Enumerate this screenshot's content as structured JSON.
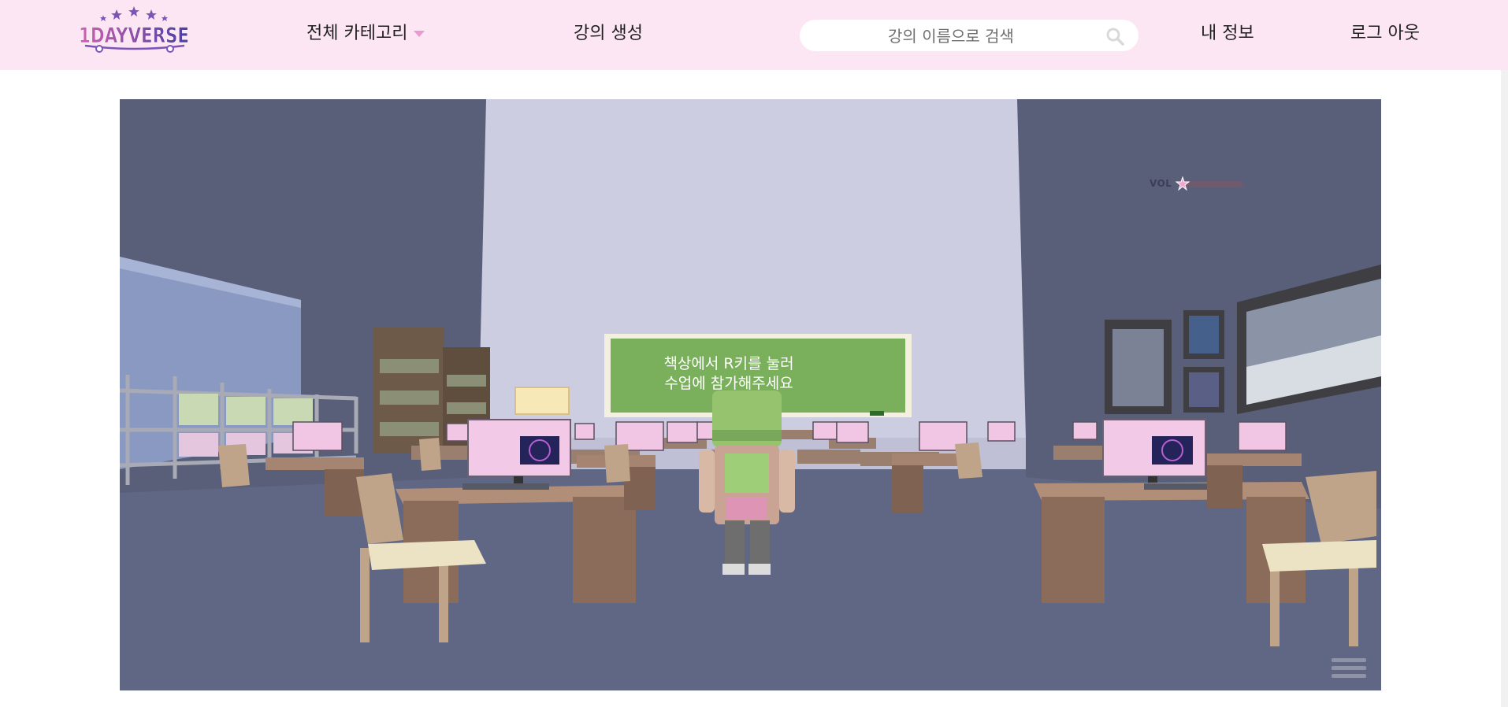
{
  "header": {
    "logo_text": "1DAYVERSE",
    "category_label": "전체 카테고리",
    "create_lecture_label": "강의 생성",
    "search_placeholder": "강의 이름으로 검색",
    "my_info_label": "내 정보",
    "logout_label": "로그 아웃"
  },
  "game": {
    "board_line_1": "책상에서 R키를 눌러",
    "board_line_2": "수업에 참가해주세요",
    "volume_label": "VOL",
    "volume_level": 0.05
  },
  "colors": {
    "header_bg": "#fde6f4",
    "board_green": "#7aaf5c",
    "floor": "#5f6785",
    "back_wall": "#cdcde2"
  }
}
